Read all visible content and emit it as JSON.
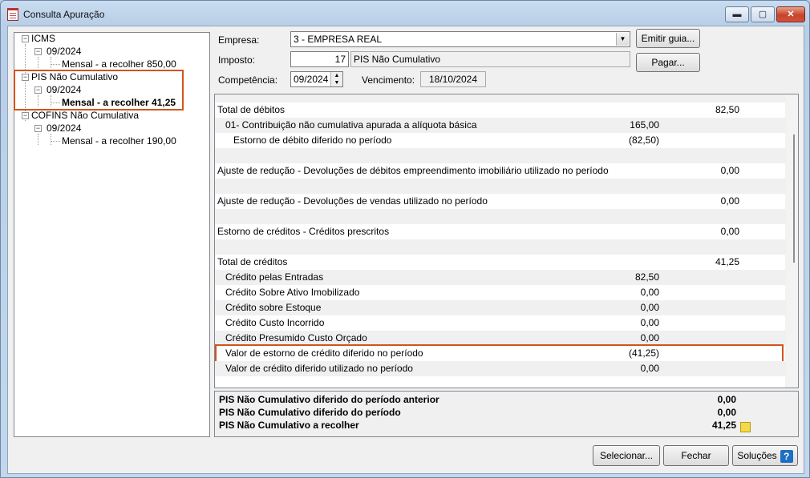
{
  "window": {
    "title": "Consulta Apuração",
    "buttons": {
      "minimize": "▬",
      "maximize": "▢",
      "close": "✕"
    }
  },
  "tree": [
    {
      "label": "ICMS",
      "children": [
        {
          "label": "09/2024",
          "children": [
            {
              "label": "Mensal - a recolher 850,00"
            }
          ]
        }
      ]
    },
    {
      "label": "PIS Não Cumulativo",
      "children": [
        {
          "label": "09/2024",
          "children": [
            {
              "label": "Mensal - a recolher 41,25",
              "selected": true
            }
          ]
        }
      ]
    },
    {
      "label": "COFINS Não Cumulativa",
      "children": [
        {
          "label": "09/2024",
          "children": [
            {
              "label": "Mensal - a recolher 190,00"
            }
          ]
        }
      ]
    }
  ],
  "form": {
    "empresa_label": "Empresa:",
    "empresa_value": "3 - EMPRESA REAL",
    "imposto_label": "Imposto:",
    "imposto_code": "17",
    "imposto_name": "PIS Não Cumulativo",
    "competencia_label": "Competência:",
    "competencia_value": "09/2024",
    "vencimento_label": "Vencimento:",
    "vencimento_value": "18/10/2024",
    "emitir_guia": "Emitir guia...",
    "pagar": "Pagar..."
  },
  "grid_rows": [
    {
      "desc": "",
      "v1": "",
      "v2": "",
      "indent": 0
    },
    {
      "desc": "Total de débitos",
      "v1": "",
      "v2": "82,50",
      "indent": 0
    },
    {
      "desc": "01- Contribuição não cumulativa apurada a alíquota básica",
      "v1": "165,00",
      "v2": "",
      "indent": 1
    },
    {
      "desc": "Estorno de débito diferido no período",
      "v1": "(82,50)",
      "v2": "",
      "indent": 2
    },
    {
      "desc": "",
      "v1": "",
      "v2": "",
      "indent": 0
    },
    {
      "desc": "Ajuste de redução - Devoluções de débitos empreendimento imobiliário utilizado no período",
      "v1": "",
      "v2": "0,00",
      "indent": 0
    },
    {
      "desc": "",
      "v1": "",
      "v2": "",
      "indent": 0
    },
    {
      "desc": "Ajuste de redução - Devoluções de vendas utilizado no período",
      "v1": "",
      "v2": "0,00",
      "indent": 0
    },
    {
      "desc": "",
      "v1": "",
      "v2": "",
      "indent": 0
    },
    {
      "desc": "Estorno de créditos - Créditos prescritos",
      "v1": "",
      "v2": "0,00",
      "indent": 0
    },
    {
      "desc": "",
      "v1": "",
      "v2": "",
      "indent": 0
    },
    {
      "desc": "Total de créditos",
      "v1": "",
      "v2": "41,25",
      "indent": 0
    },
    {
      "desc": "Crédito pelas Entradas",
      "v1": "82,50",
      "v2": "",
      "indent": 1
    },
    {
      "desc": "Crédito Sobre Ativo Imobilizado",
      "v1": "0,00",
      "v2": "",
      "indent": 1
    },
    {
      "desc": "Crédito sobre Estoque",
      "v1": "0,00",
      "v2": "",
      "indent": 1
    },
    {
      "desc": "Crédito Custo Incorrido",
      "v1": "0,00",
      "v2": "",
      "indent": 1
    },
    {
      "desc": "Crédito Presumido Custo Orçado",
      "v1": "0,00",
      "v2": "",
      "indent": 1
    },
    {
      "desc": "Valor de estorno de crédito diferido no período",
      "v1": "(41,25)",
      "v2": "",
      "indent": 1,
      "highlight": true
    },
    {
      "desc": "Valor de crédito diferido utilizado no período",
      "v1": "0,00",
      "v2": "",
      "indent": 1
    }
  ],
  "summary": [
    {
      "label": "PIS Não Cumulativo diferido do período anterior",
      "value": "0,00"
    },
    {
      "label": "PIS Não Cumulativo diferido do período",
      "value": "0,00"
    },
    {
      "label": "PIS Não Cumulativo a recolher",
      "value": "41,25"
    }
  ],
  "footer": {
    "selecionar": "Selecionar...",
    "fechar": "Fechar",
    "solucoes": "Soluções",
    "help_glyph": "?"
  },
  "colors": {
    "highlight": "#d2541a",
    "alt_row": "#f0f0f0"
  }
}
